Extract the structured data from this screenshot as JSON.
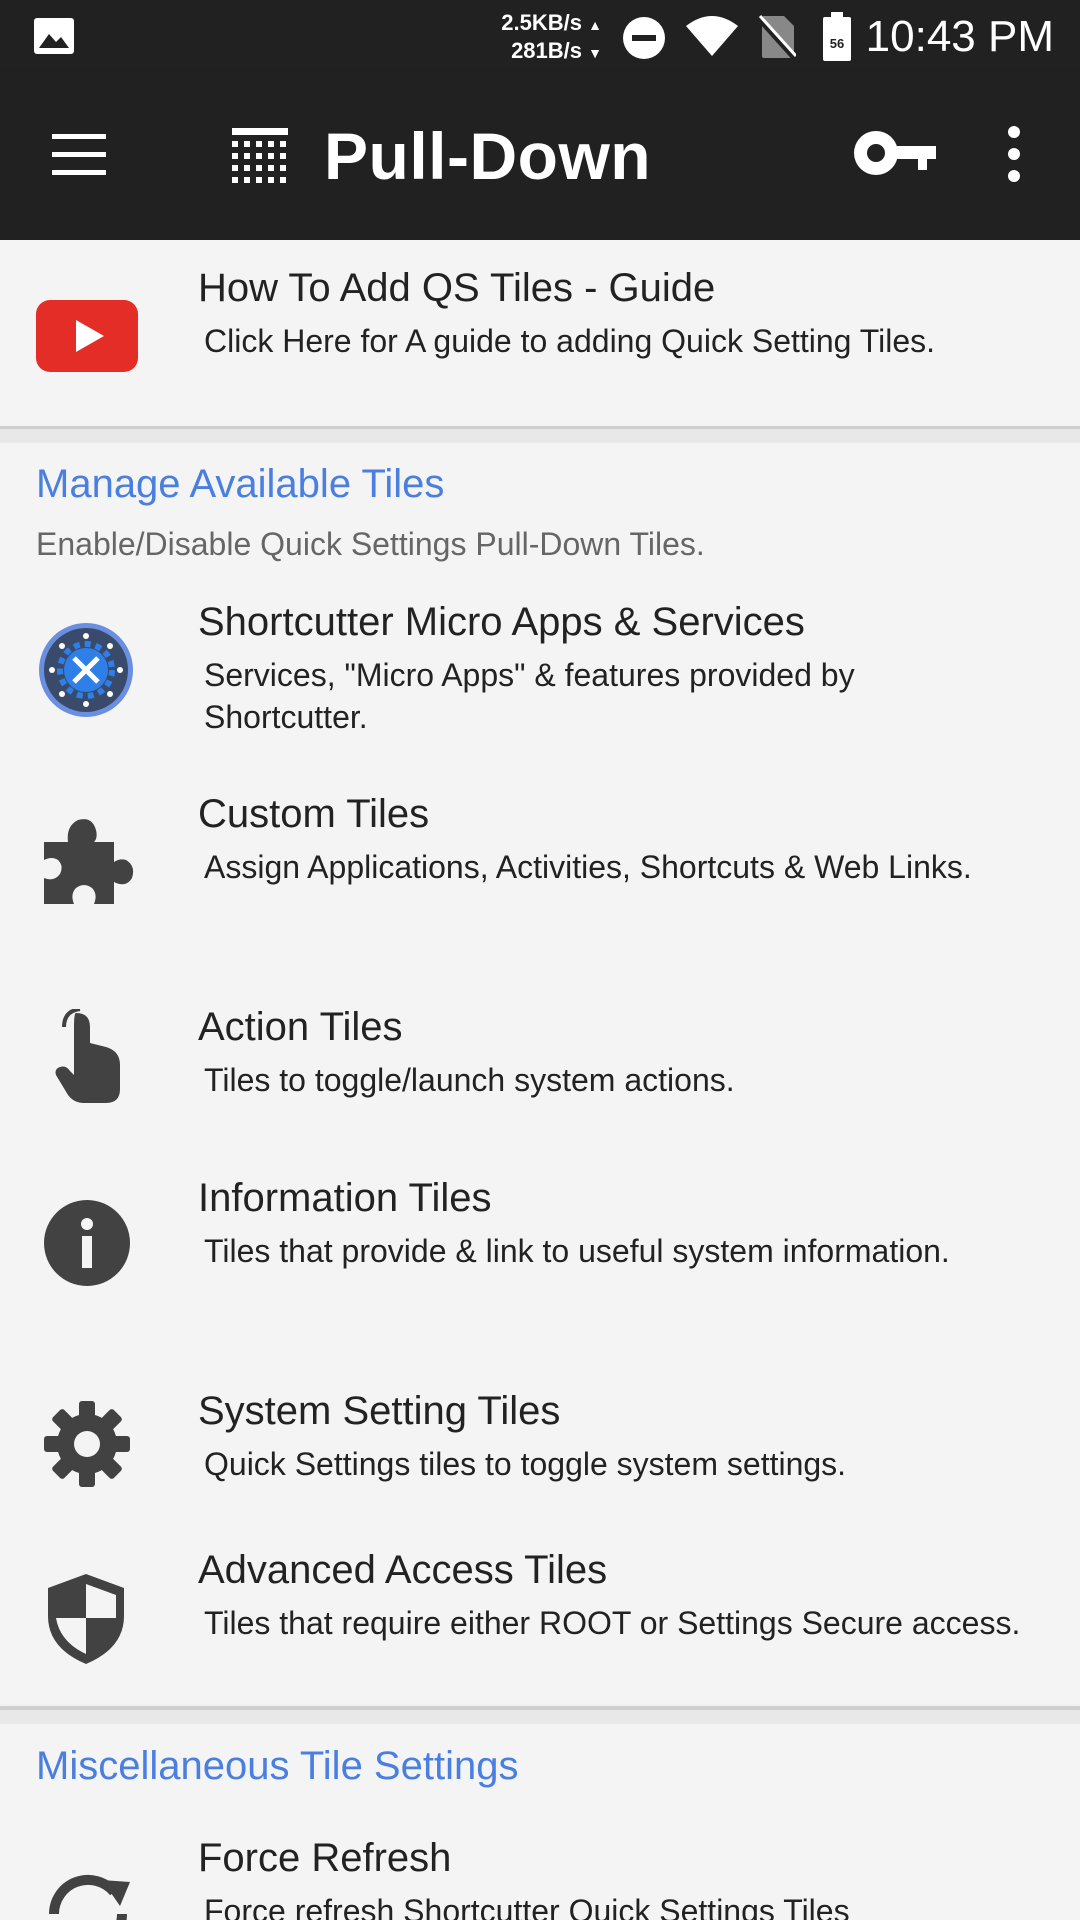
{
  "status_bar": {
    "net_down": "2.5KB/s",
    "net_up": "281B/s",
    "time": "10:43 PM",
    "battery_level": "56",
    "icons": [
      "gallery-icon",
      "dnd-icon",
      "wifi-icon",
      "no-sim-icon",
      "battery-icon"
    ]
  },
  "toolbar": {
    "title": "Pull-Down",
    "icons": [
      "menu-icon",
      "grid-icon",
      "key-icon",
      "more-vert-icon"
    ]
  },
  "banner": {
    "title": "How To Add QS Tiles - Guide",
    "subtitle": "Click Here for A guide to adding Quick Setting Tiles.",
    "icon": "youtube-icon",
    "icon_color": "#e52d27"
  },
  "section_available": {
    "title": "Manage Available Tiles",
    "subtitle": "Enable/Disable Quick Settings Pull-Down Tiles.",
    "accent": "#4a7fe0",
    "items": [
      {
        "title": "Shortcutter Micro Apps & Services",
        "subtitle": "Services, \"Micro Apps\" & features provided by Shortcutter.",
        "icon": "shortcutter-gear-icon"
      },
      {
        "title": "Custom Tiles",
        "subtitle": "Assign Applications, Activities, Shortcuts & Web Links.",
        "icon": "puzzle-icon"
      },
      {
        "title": "Action Tiles",
        "subtitle": "Tiles to toggle/launch system actions.",
        "icon": "touch-icon"
      },
      {
        "title": "Information Tiles",
        "subtitle": "Tiles that provide & link to useful system information.",
        "icon": "info-icon"
      },
      {
        "title": "System Setting Tiles",
        "subtitle": "Quick Settings tiles to toggle system settings.",
        "icon": "settings-gear-icon"
      },
      {
        "title": "Advanced Access Tiles",
        "subtitle": "Tiles that require either ROOT or Settings Secure access.",
        "icon": "shield-icon"
      }
    ]
  },
  "section_misc": {
    "title": "Miscellaneous Tile Settings",
    "items": [
      {
        "title": "Force Refresh",
        "subtitle": "Force refresh Shortcutter Quick Settings Tiles",
        "icon": "refresh-icon"
      }
    ]
  }
}
